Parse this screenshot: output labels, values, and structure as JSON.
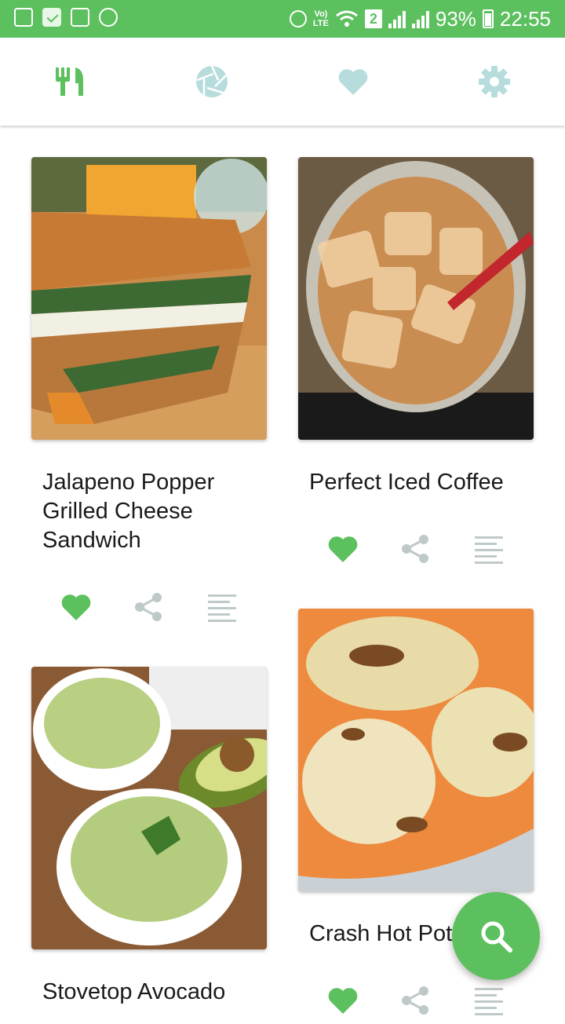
{
  "status_bar": {
    "volte": "Vo)",
    "lte": "LTE",
    "sim": "2",
    "battery": "93%",
    "time": "22:55"
  },
  "tabs": [
    {
      "icon": "fork-knife-icon",
      "active": true
    },
    {
      "icon": "camera-aperture-icon",
      "active": false
    },
    {
      "icon": "heart-icon",
      "active": false
    },
    {
      "icon": "gear-icon",
      "active": false
    }
  ],
  "colors": {
    "accent": "#5cc05f",
    "inactive_icon": "#b7dcdc",
    "muted_icon": "#bfc9c9"
  },
  "recipes": [
    {
      "title": "Jalapeno Popper Grilled Cheese Sandwich",
      "favorited": true
    },
    {
      "title": "Perfect Iced Coffee",
      "favorited": true
    },
    {
      "title": "Stovetop Avocado",
      "favorited": true
    },
    {
      "title": "Crash Hot Pot",
      "favorited": true
    }
  ],
  "fab": {
    "icon": "search-icon"
  }
}
